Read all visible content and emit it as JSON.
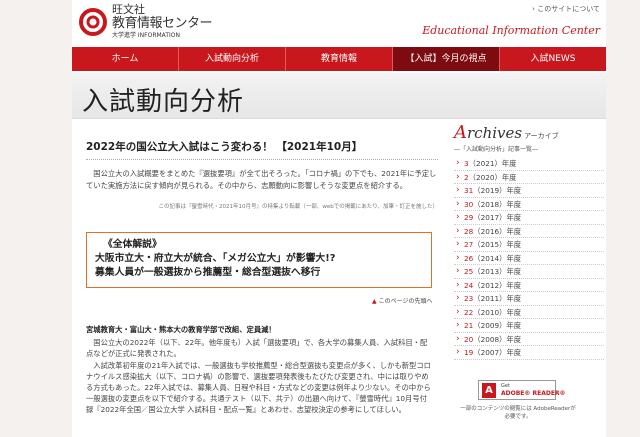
{
  "header": {
    "brand_name": "旺文社",
    "brand_sub": "教育情報センター",
    "brand_tag": "大学進学 INFORMATION",
    "about_link": "› このサイトについて",
    "site_title": "Educational Information Center"
  },
  "nav": {
    "items": [
      {
        "label": "ホーム"
      },
      {
        "label": "入試動向分析"
      },
      {
        "label": "教育情報"
      },
      {
        "label": "【入試】今月の視点"
      },
      {
        "label": "入試NEWS"
      }
    ]
  },
  "page": {
    "title": "入試動向分析"
  },
  "article": {
    "title": "2022年の国公立大入試はこう変わる！ 【2021年10月】",
    "lead": "国公立大の入試概要をまとめた『選抜要項』が全て出そろった。「コロナ禍」の下でも、2021年に予定していた実施方法に戻す傾向が見られる。その中から、志願動向に影響しそうな変更点を紹介する。",
    "note": "この記事は『螢雪時代・2021年10月号』の特集より転載（一部、webでの掲載にあたり、加筆・訂正を施した）",
    "callout": {
      "line1": "《全体解説》",
      "line2": "大阪市立大・府立大が統合、「メガ公立大」が影響大!?",
      "line3": "募集人員が一般選抜から推薦型・総合型選抜へ移行"
    },
    "more_link": "このページの先頭へ",
    "subhead": "宮城教育大・富山大・熊本大の教育学部で改組、定員減！",
    "para1": "国公立大の2022年（以下、22年。他年度も）入試「選抜要項」で、各大学の募集人員、入試科目・配点などが正式に発表された。",
    "para2": "入試改革初年度の21年入試では、一般選抜も学校推薦型・総合型選抜も変更点が多く、しかも新型コロナウイルス感染拡大（以下、コロナ禍）の影響で、選抜要項発表後もたびたび変更され、中には取りやめる方式もあった。22年入試では、募集人員、日程や科目・方式などの変更は例年より少ない。その中から一般選抜の変更点を以下で紹介する。共通テスト（以下、共テ）の出題へ向けて、『螢雪時代』10月号付録『2022年全国／国公立大学 入試科目・配点一覧』とあわせ、志望校決定の参考にしてほしい。"
  },
  "archives": {
    "title_cap": "A",
    "title_rest": "rchives",
    "title_jp": "アーカイブ",
    "subtitle": "―「入試動向分析」記事一覧―",
    "items": [
      {
        "num": "3",
        "label": "（2021）年度"
      },
      {
        "num": "2",
        "label": "（2020）年度"
      },
      {
        "num": "31",
        "label": "（2019）年度"
      },
      {
        "num": "30",
        "label": "（2018）年度"
      },
      {
        "num": "29",
        "label": "（2017）年度"
      },
      {
        "num": "28",
        "label": "（2016）年度"
      },
      {
        "num": "27",
        "label": "（2015）年度"
      },
      {
        "num": "26",
        "label": "（2014）年度"
      },
      {
        "num": "25",
        "label": "（2013）年度"
      },
      {
        "num": "24",
        "label": "（2012）年度"
      },
      {
        "num": "23",
        "label": "（2011）年度"
      },
      {
        "num": "22",
        "label": "（2010）年度"
      },
      {
        "num": "21",
        "label": "（2009）年度"
      },
      {
        "num": "20",
        "label": "（2008）年度"
      },
      {
        "num": "19",
        "label": "（2007）年度"
      }
    ]
  },
  "adobe": {
    "get": "Get",
    "name": "ADOBE® READER®",
    "note": "一部のコンテンツの閲覧には AdobeReaderが必要です。"
  },
  "colors": {
    "brand_red": "#c8181e",
    "nav_active": "#7d0b0f",
    "callout_border": "#e0702a"
  }
}
